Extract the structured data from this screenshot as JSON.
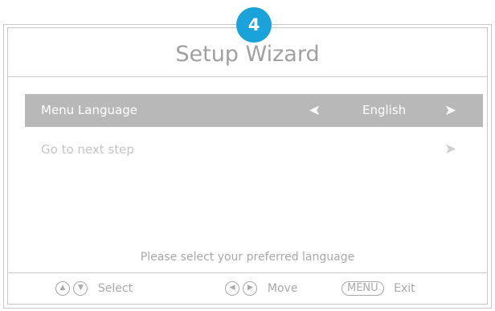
{
  "wizard": {
    "step_number": "4",
    "title": "Setup Wizard",
    "hint": "Please select your preferred language"
  },
  "rows": {
    "language": {
      "label": "Menu Language",
      "value": "English",
      "arrow_left": "➤",
      "arrow_right": "➤"
    },
    "next": {
      "label": "Go to next step",
      "arrow_right": "➤"
    }
  },
  "footer": {
    "select_label": "Select",
    "move_label": "Move",
    "exit_key": "MENU",
    "exit_label": "Exit"
  },
  "colors": {
    "accent": "#1aa3db",
    "highlight_row": "#b8b8b8",
    "frame": "#c8c8c8",
    "text_muted": "#a8a8a8"
  }
}
